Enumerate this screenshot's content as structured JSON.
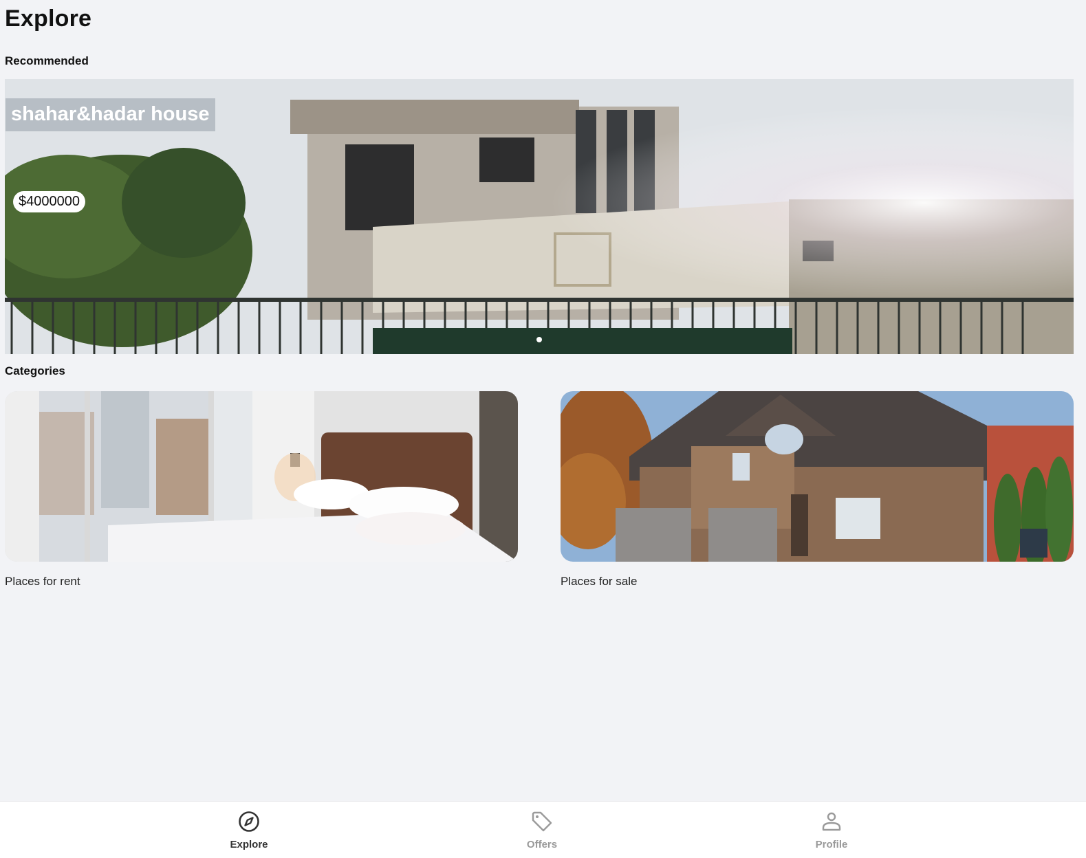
{
  "header": {
    "title": "Explore"
  },
  "recommended": {
    "section_title": "Recommended",
    "items": [
      {
        "title": "shahar&hadar house",
        "price": "$4000000"
      }
    ],
    "active_index": 0
  },
  "categories": {
    "section_title": "Categories",
    "items": [
      {
        "label": "Places for rent",
        "image": "bedroom-photo"
      },
      {
        "label": "Places for sale",
        "image": "house-exterior-photo"
      }
    ]
  },
  "bottom_nav": {
    "items": [
      {
        "label": "Explore",
        "icon": "compass-icon",
        "active": true
      },
      {
        "label": "Offers",
        "icon": "tag-icon",
        "active": false
      },
      {
        "label": "Profile",
        "icon": "user-icon",
        "active": false
      }
    ]
  },
  "colors": {
    "background": "#f2f3f6",
    "nav_active": "#333333",
    "nav_inactive": "#9a9a9a"
  }
}
